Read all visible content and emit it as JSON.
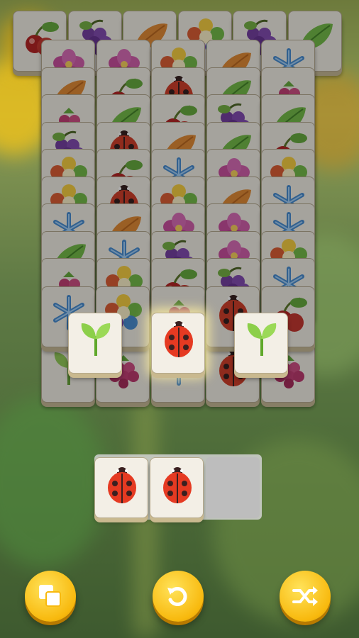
{
  "game": {
    "title": "",
    "colors": {
      "accent": "#f8b90e",
      "tile_face": "#f3efe6",
      "tray": "#d2d2d2"
    }
  },
  "tiles_top_row": [
    "cherry",
    "grape",
    "leaf-orange",
    "flower",
    "grape",
    "leaf-green"
  ],
  "board": {
    "rows": [
      [
        "flower-pink",
        "flower-pink",
        "flower",
        "leaf-orange",
        "snowflake"
      ],
      [
        "leaf-orange",
        "cherry",
        "ladybug",
        "leaf-green",
        "raspberry"
      ],
      [
        "raspberry",
        "leaf-green",
        "cherry",
        "grape",
        "leaf-green"
      ],
      [
        "grape",
        "ladybug",
        "leaf-orange",
        "leaf-green",
        "cherry"
      ],
      [
        "flower",
        "cherry",
        "snowflake",
        "flower-pink",
        "flower"
      ],
      [
        "flower",
        "ladybug",
        "flower",
        "leaf-orange",
        "snowflake"
      ],
      [
        "snowflake",
        "leaf-orange",
        "flower-pink",
        "flower-pink",
        "snowflake"
      ],
      [
        "leaf-green",
        "snowflake",
        "grape",
        "flower-pink",
        "flower"
      ],
      [
        "raspberry",
        "flower",
        "cherry",
        "grape",
        "snowflake"
      ]
    ],
    "top_tiles": [
      "sprout",
      "ladybug",
      "sprout"
    ]
  },
  "tray": {
    "slots": [
      "ladybug",
      "ladybug"
    ]
  },
  "buttons": [
    {
      "name": "undo-tiles-button",
      "icon": "copy-icon"
    },
    {
      "name": "undo-button",
      "icon": "undo-icon"
    },
    {
      "name": "shuffle-button",
      "icon": "shuffle-icon"
    }
  ]
}
